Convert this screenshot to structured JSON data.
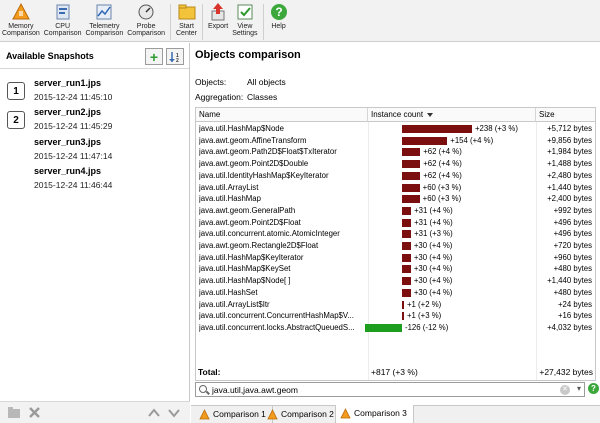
{
  "toolbar": {
    "buttons": [
      {
        "label": "Memory\nComparison",
        "icon": "memory-comparison-icon"
      },
      {
        "label": "CPU\nComparison",
        "icon": "cpu-comparison-icon"
      },
      {
        "label": "Telemetry\nComparison",
        "icon": "telemetry-comparison-icon"
      },
      {
        "label": "Probe\nComparison",
        "icon": "probe-comparison-icon"
      },
      {
        "label": "Start\nCenter",
        "icon": "start-center-icon"
      },
      {
        "label": "Export",
        "icon": "export-icon"
      },
      {
        "label": "View\nSettings",
        "icon": "view-settings-icon"
      },
      {
        "label": "Help",
        "icon": "help-icon"
      }
    ]
  },
  "left": {
    "title": "Available Snapshots",
    "snapshots": [
      {
        "num": "1",
        "name": "server_run1.jps",
        "time": "2015-12-24 11:45:10"
      },
      {
        "num": "2",
        "name": "server_run2.jps",
        "time": "2015-12-24 11:45:29"
      },
      {
        "num": "",
        "name": "server_run3.jps",
        "time": "2015-12-24 11:47:14"
      },
      {
        "num": "",
        "name": "server_run4.jps",
        "time": "2015-12-24 11:46:44"
      }
    ]
  },
  "main": {
    "title": "Objects comparison",
    "objects_label": "Objects:",
    "objects_value": "All objects",
    "aggregation_label": "Aggregation:",
    "aggregation_value": "Classes",
    "columns": {
      "name": "Name",
      "count": "Instance count",
      "size": "Size"
    },
    "rows": [
      {
        "name": "java.util.HashMap$Node",
        "count": "+238 (+3 %)",
        "delta": 238,
        "size": "+5,712 bytes"
      },
      {
        "name": "java.awt.geom.AffineTransform",
        "count": "+154 (+4 %)",
        "delta": 154,
        "size": "+9,856 bytes"
      },
      {
        "name": "java.awt.geom.Path2D$Float$TxIterator",
        "count": "+62 (+4 %)",
        "delta": 62,
        "size": "+1,984 bytes"
      },
      {
        "name": "java.awt.geom.Point2D$Double",
        "count": "+62 (+4 %)",
        "delta": 62,
        "size": "+1,488 bytes"
      },
      {
        "name": "java.util.IdentityHashMap$KeyIterator",
        "count": "+62 (+4 %)",
        "delta": 62,
        "size": "+2,480 bytes"
      },
      {
        "name": "java.util.ArrayList",
        "count": "+60 (+3 %)",
        "delta": 60,
        "size": "+1,440 bytes"
      },
      {
        "name": "java.util.HashMap",
        "count": "+60 (+3 %)",
        "delta": 60,
        "size": "+2,400 bytes"
      },
      {
        "name": "java.awt.geom.GeneralPath",
        "count": "+31 (+4 %)",
        "delta": 31,
        "size": "+992 bytes"
      },
      {
        "name": "java.awt.geom.Point2D$Float",
        "count": "+31 (+4 %)",
        "delta": 31,
        "size": "+496 bytes"
      },
      {
        "name": "java.util.concurrent.atomic.AtomicInteger",
        "count": "+31 (+3 %)",
        "delta": 31,
        "size": "+496 bytes"
      },
      {
        "name": "java.awt.geom.Rectangle2D$Float",
        "count": "+30 (+4 %)",
        "delta": 30,
        "size": "+720 bytes"
      },
      {
        "name": "java.util.HashMap$KeyIterator",
        "count": "+30 (+4 %)",
        "delta": 30,
        "size": "+960 bytes"
      },
      {
        "name": "java.util.HashMap$KeySet",
        "count": "+30 (+4 %)",
        "delta": 30,
        "size": "+480 bytes"
      },
      {
        "name": "java.util.HashMap$Node[ ]",
        "count": "+30 (+4 %)",
        "delta": 30,
        "size": "+1,440 bytes"
      },
      {
        "name": "java.util.HashSet",
        "count": "+30 (+4 %)",
        "delta": 30,
        "size": "+480 bytes"
      },
      {
        "name": "java.util.ArrayList$Itr",
        "count": "+1 (+2 %)",
        "delta": 1,
        "size": "+24 bytes"
      },
      {
        "name": "java.util.concurrent.ConcurrentHashMap$V...",
        "count": "+1 (+3 %)",
        "delta": 1,
        "size": "+16 bytes"
      },
      {
        "name": "java.util.concurrent.locks.AbstractQueuedS...",
        "count": "-126 (-12 %)",
        "delta": -126,
        "size": "+4,032 bytes"
      }
    ],
    "total_label": "Total:",
    "total_count": "+817 (+3 %)",
    "total_size": "+27,432 bytes",
    "filter_value": "java.util,java.awt.geom",
    "tabs": [
      "Comparison 1",
      "Comparison 2",
      "Comparison 3"
    ],
    "active_tab": 2
  },
  "colors": {
    "positive_bar": "#7b0f0f",
    "negative_bar": "#1e9e1e"
  }
}
